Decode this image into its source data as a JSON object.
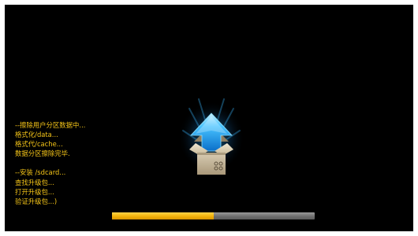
{
  "log": {
    "lines": [
      "--擦除用户分区数据中...",
      "格式化/data...",
      "格式代/cache...",
      "数据分区擦除完毕.",
      "",
      "--安装 /sdcard...",
      "查找升级包...",
      "打开升级包...",
      "验证升级包...)"
    ]
  },
  "icon": {
    "name": "system-update-icon"
  },
  "progress": {
    "fraction": 0.5
  },
  "colors": {
    "screen_background": "#000000",
    "log_text": "#f5c518",
    "progress_fill": "#f4b60e",
    "progress_track": "#7a7a7a",
    "arrow": "#2fb4ff"
  }
}
